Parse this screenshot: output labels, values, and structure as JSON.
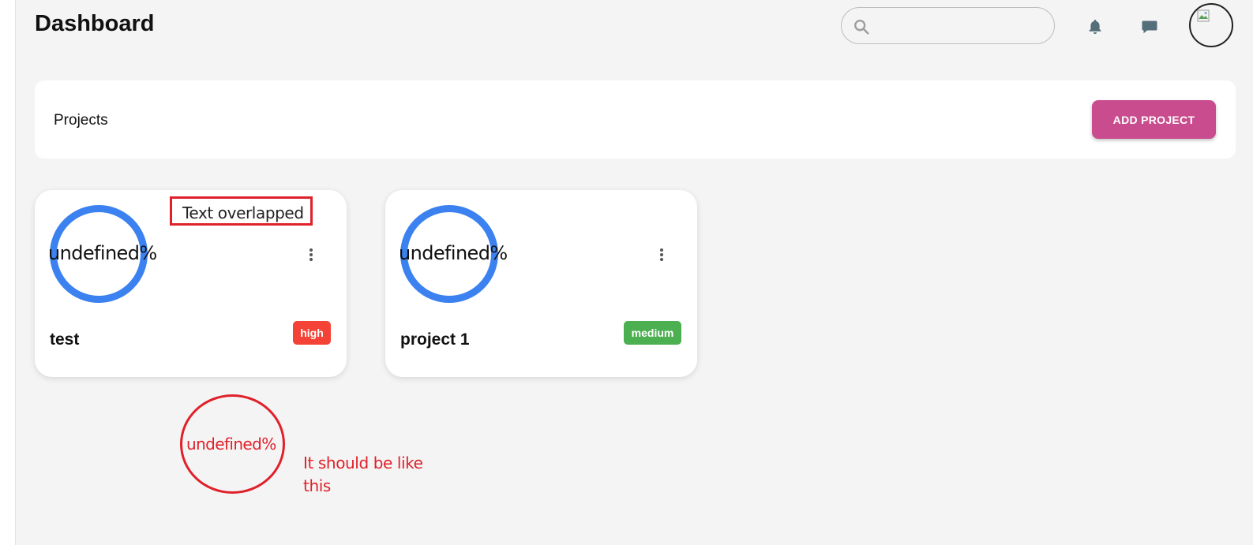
{
  "header": {
    "title": "Dashboard",
    "search": {
      "value": "",
      "placeholder": ""
    },
    "icons": [
      "search-icon",
      "bell-icon",
      "chat-icon",
      "avatar"
    ]
  },
  "projects_bar": {
    "label": "Projects",
    "add_button_label": "ADD PROJECT"
  },
  "cards": [
    {
      "progress_text": "undefined%",
      "title": "test",
      "priority": "high",
      "priority_color": "#f44336"
    },
    {
      "progress_text": "undefined%",
      "title": "project 1",
      "priority": "medium",
      "priority_color": "#4caf50"
    }
  ],
  "annotations": {
    "overlap_label": "Text overlapped",
    "expected_ring_text": "undefined%",
    "note": "It should be like this"
  },
  "colors": {
    "accent": "#c94d8e",
    "ring": "#3b82f0",
    "annotation": "#e0202a"
  }
}
